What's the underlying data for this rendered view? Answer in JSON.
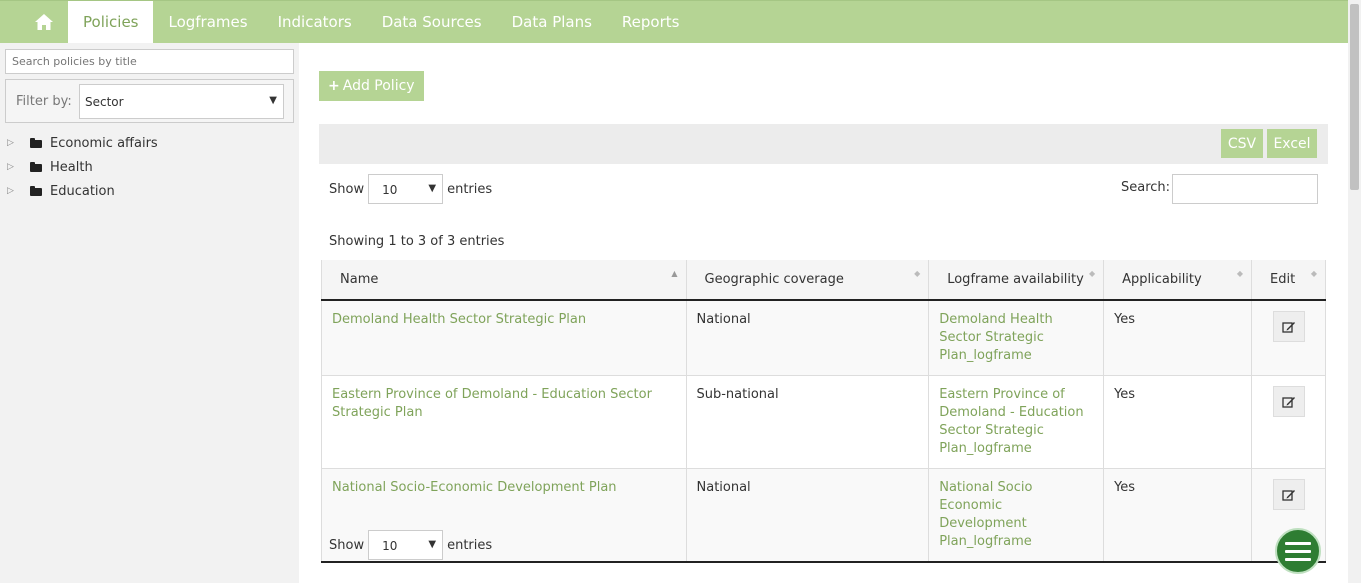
{
  "nav": {
    "home_icon": "home-icon",
    "items": [
      {
        "label": "Policies",
        "active": true
      },
      {
        "label": "Logframes"
      },
      {
        "label": "Indicators"
      },
      {
        "label": "Data Sources"
      },
      {
        "label": "Data Plans"
      },
      {
        "label": "Reports"
      }
    ]
  },
  "sidebar": {
    "search_placeholder": "Search policies by title",
    "filter_label": "Filter by:",
    "filter_value": "Sector",
    "tree": [
      "Economic affairs",
      "Health",
      "Education"
    ]
  },
  "main": {
    "add_button": "Add Policy",
    "csv_label": "CSV",
    "excel_label": "Excel",
    "show_label": "Show",
    "entries_label": "entries",
    "page_length": "10",
    "search_label": "Search:",
    "info": "Showing 1 to 3 of 3 entries",
    "columns": [
      "Name",
      "Geographic coverage",
      "Logframe availability",
      "Applicability",
      "Edit"
    ],
    "rows": [
      {
        "name": "Demoland Health Sector Strategic Plan",
        "coverage": "National",
        "logframe": "Demoland Health Sector Strategic Plan_logframe",
        "applicability": "Yes"
      },
      {
        "name": "Eastern Province of Demoland - Education Sector Strategic Plan",
        "coverage": "Sub-national",
        "logframe": "Eastern Province of Demoland - Education Sector Strategic Plan_logframe",
        "applicability": "Yes"
      },
      {
        "name": "National Socio-Economic Development Plan",
        "coverage": "National",
        "logframe": "National Socio Economic Development Plan_logframe",
        "applicability": "Yes"
      }
    ]
  },
  "colors": {
    "accent": "#b5d494",
    "link": "#7fa35a",
    "fab": "#2e7d32"
  }
}
